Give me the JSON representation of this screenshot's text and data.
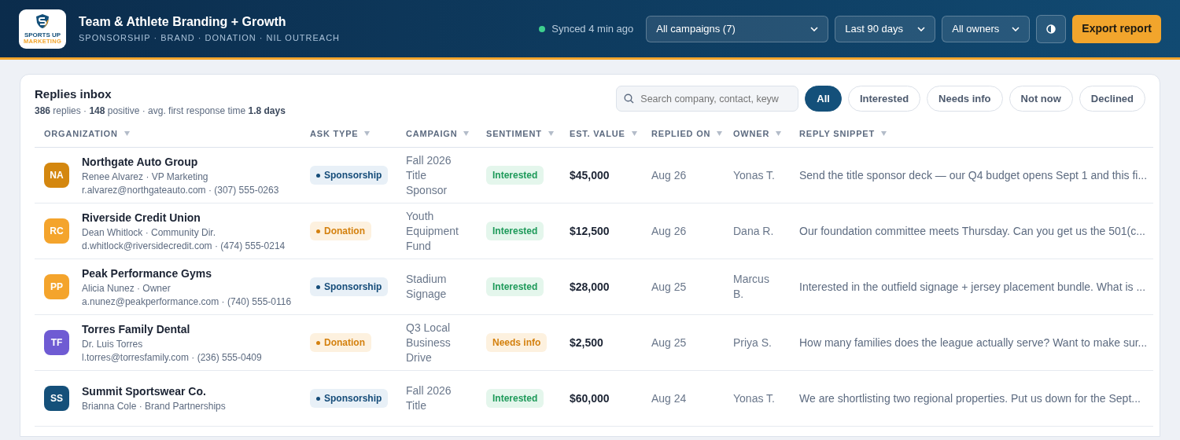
{
  "header": {
    "logo_text": "SPORTS UP",
    "logo_subtext": "MARKETING",
    "title": "Team & Athlete Branding + Growth",
    "subtitle": "SPONSORSHIP · BRAND · DONATION · NIL OUTREACH",
    "sync_status": "Synced 4 min ago",
    "filters": [
      {
        "value": "All campaigns (7)"
      },
      {
        "value": "Last 90 days"
      },
      {
        "value": "All owners"
      }
    ],
    "export_button": "Export report"
  },
  "inbox": {
    "title": "Replies inbox",
    "summary": "**386** replies · **148** positive · avg. first response time **1.8 days**",
    "search": {
      "placeholder": "Search company, contact, keyw"
    },
    "chips": [
      {
        "label": "All",
        "selected": true
      },
      {
        "label": "Interested",
        "selected": false
      },
      {
        "label": "Needs info",
        "selected": false
      },
      {
        "label": "Not now",
        "selected": false
      },
      {
        "label": "Declined",
        "selected": false
      }
    ]
  },
  "table": {
    "columns": [
      "ORGANIZATION",
      "ASK TYPE",
      "CAMPAIGN",
      "SENTIMENT",
      "EST. VALUE",
      "REPLIED ON",
      "OWNER",
      "REPLY SNIPPET"
    ],
    "rows": [
      {
        "initials": "NA",
        "color": "#d4870f",
        "organization": "Northgate Auto Group",
        "contact": "Renee Alvarez · VP Marketing",
        "details": "r.alvarez@northgateauto.com · (307) 555-0263",
        "ask_type": {
          "kind": "sponsorship",
          "label": "Sponsorship"
        },
        "campaign": "Fall 2026 Title Sponsor",
        "sentiment": {
          "kind": "interested",
          "label": "Interested"
        },
        "value": "$45,000",
        "replied_on": "Aug 26",
        "owner": "Yonas T.",
        "snippet": "Send the title sponsor deck — our Q4 budget opens Sept 1 and this fi..."
      },
      {
        "initials": "RC",
        "color": "#f4a42c",
        "organization": "Riverside Credit Union",
        "contact": "Dean Whitlock · Community Dir.",
        "details": "d.whitlock@riversidecredit.com · (474) 555-0214",
        "ask_type": {
          "kind": "donation",
          "label": "Donation"
        },
        "campaign": "Youth Equipment Fund",
        "sentiment": {
          "kind": "interested",
          "label": "Interested"
        },
        "value": "$12,500",
        "replied_on": "Aug 26",
        "owner": "Dana R.",
        "snippet": "Our foundation committee meets Thursday. Can you get us the 501(c..."
      },
      {
        "initials": "PP",
        "color": "#f4a42c",
        "organization": "Peak Performance Gyms",
        "contact": "Alicia Nunez · Owner",
        "details": "a.nunez@peakperformance.com · (740) 555-0116",
        "ask_type": {
          "kind": "sponsorship",
          "label": "Sponsorship"
        },
        "campaign": "Stadium Signage",
        "sentiment": {
          "kind": "interested",
          "label": "Interested"
        },
        "value": "$28,000",
        "replied_on": "Aug 25",
        "owner": "Marcus B.",
        "snippet": "Interested in the outfield signage + jersey placement bundle. What is ..."
      },
      {
        "initials": "TF",
        "color": "#6f5bd3",
        "organization": "Torres Family Dental",
        "contact": "Dr. Luis Torres",
        "details": "l.torres@torresfamily.com · (236) 555-0409",
        "ask_type": {
          "kind": "donation",
          "label": "Donation"
        },
        "campaign": "Q3 Local Business Drive",
        "sentiment": {
          "kind": "needs_info",
          "label": "Needs info"
        },
        "value": "$2,500",
        "replied_on": "Aug 25",
        "owner": "Priya S.",
        "snippet": "How many families does the league actually serve? Want to make sur..."
      },
      {
        "initials": "SS",
        "color": "#15507a",
        "organization": "Summit Sportswear Co.",
        "contact": "Brianna Cole · Brand Partnerships",
        "ask_type": {
          "kind": "sponsorship",
          "label": "Sponsorship"
        },
        "campaign": "Fall 2026 Title",
        "sentiment": {
          "kind": "interested",
          "label": "Interested"
        },
        "value": "$60,000",
        "replied_on": "Aug 24",
        "owner": "Yonas T.",
        "snippet": "We are shortlisting two regional properties. Put us down for the Sept..."
      }
    ]
  }
}
